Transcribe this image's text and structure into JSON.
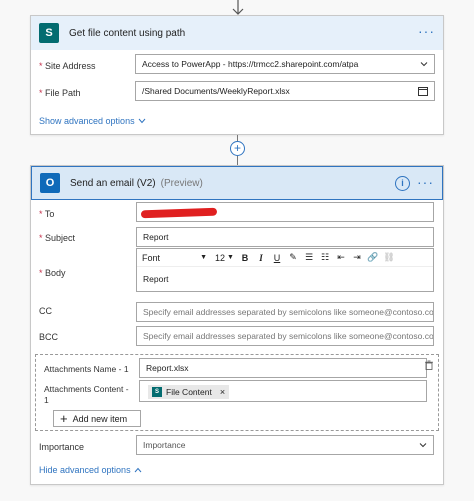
{
  "card1": {
    "title": "Get file content using path",
    "site_address": {
      "label": "Site Address",
      "value": "Access to PowerApp - https://trmcc2.sharepoint.com/atpa"
    },
    "file_path": {
      "label": "File Path",
      "value": "/Shared Documents/WeeklyReport.xlsx"
    },
    "advanced_link": "Show advanced options"
  },
  "card2": {
    "title": "Send an email (V2)",
    "preview": "(Preview)",
    "to": {
      "label": "To",
      "value": ""
    },
    "subject": {
      "label": "Subject",
      "value": "Report"
    },
    "body": {
      "label": "Body",
      "font": "Font",
      "size": "12",
      "content": "Report"
    },
    "cc": {
      "label": "CC",
      "placeholder": "Specify email addresses separated by semicolons like someone@contoso.com"
    },
    "bcc": {
      "label": "BCC",
      "placeholder": "Specify email addresses separated by semicolons like someone@contoso.com"
    },
    "attachments": {
      "name_label": "Attachments Name - 1",
      "name_value": "Report.xlsx",
      "content_label": "Attachments Content - 1",
      "content_chip": "File Content",
      "add_button": "Add new item"
    },
    "importance": {
      "label": "Importance",
      "value": "Importance"
    },
    "advanced_link": "Hide advanced options"
  },
  "colors": {
    "accent": "#2f74c0",
    "required": "#c4314b",
    "sharepoint": "#036c70",
    "outlook": "#0f6ab9"
  }
}
